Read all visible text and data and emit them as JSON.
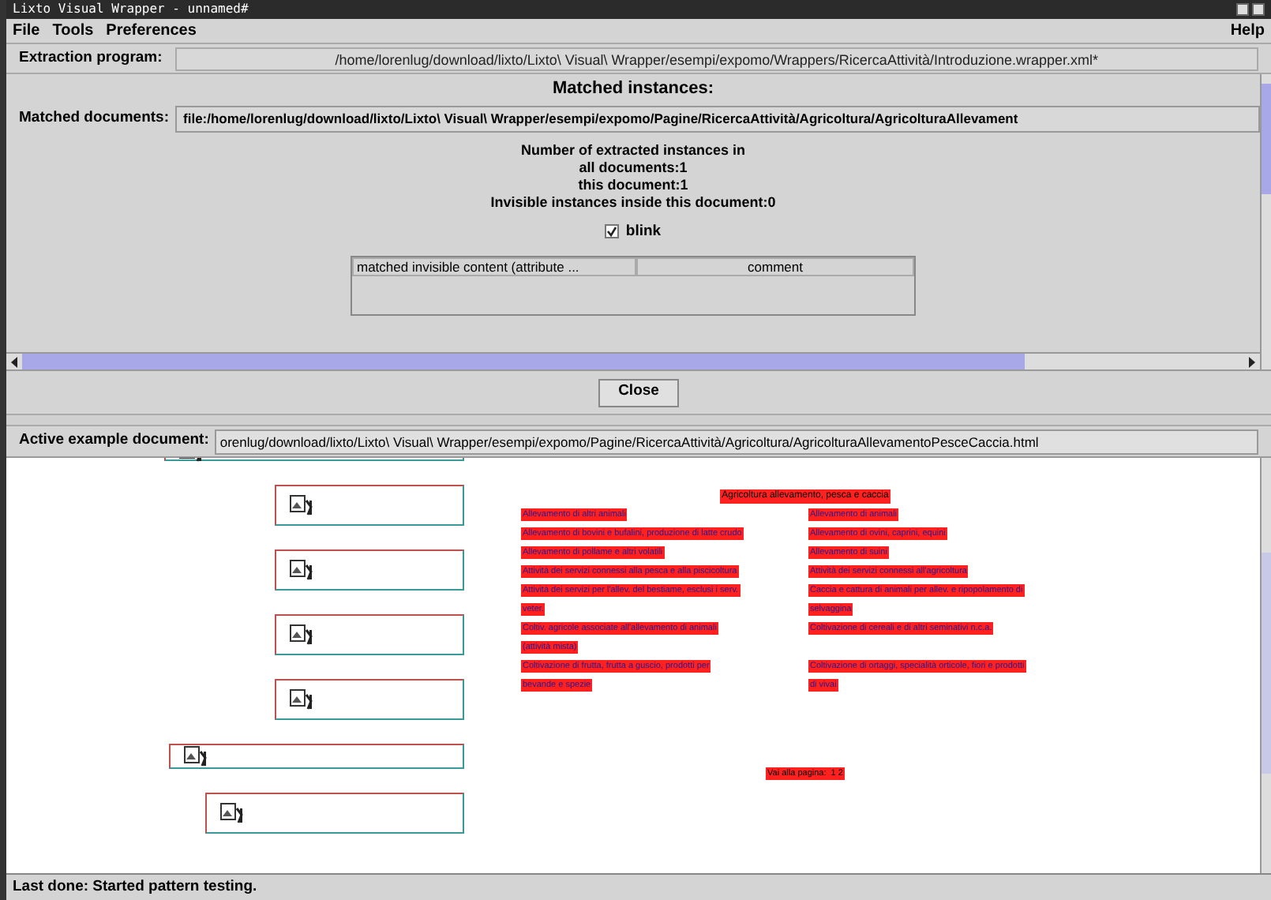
{
  "window": {
    "title": "Lixto Visual Wrapper - unnamed#"
  },
  "menu": [
    {
      "label": "File"
    },
    {
      "label": "Tools"
    },
    {
      "label": "Preferences"
    }
  ],
  "help_menu": "Help",
  "extraction_program": {
    "label": "Extraction program:",
    "value": "/home/lorenlug/download/lixto/Lixto\\ Visual\\ Wrapper/esempi/expomo/Wrappers/RicercaAttività/Introduzione.wrapper.xml*"
  },
  "matched": {
    "title": "Matched instances:",
    "documents_label": "Matched documents:",
    "documents_value": "file:/home/lorenlug/download/lixto/Lixto\\ Visual\\ Wrapper/esempi/expomo/Pagine/RicercaAttività/Agricoltura/AgricolturaAllevament",
    "counts": [
      "Number of extracted instances in",
      "all documents:1",
      "this document:1",
      "Invisible instances inside this document:0"
    ],
    "blink": {
      "label": "blink",
      "checked": true
    },
    "table_columns": [
      "matched invisible content (attribute ...",
      "comment"
    ]
  },
  "close_button": "Close",
  "active_document": {
    "label": "Active example document:",
    "value": "orenlug/download/lixto/Lixto\\ Visual\\ Wrapper/esempi/expomo/Pagine/RicercaAttività/Agricoltura/AgricolturaAllevamentoPesceCaccia.html"
  },
  "document": {
    "heading": "Agricoltura allevamento, pesca e caccia",
    "link_rows": [
      {
        "left": "Allevamento di altri animali",
        "right": "Allevamento di animali"
      },
      {
        "left": "Allevamento di bovini e bufalini, produzione di latte crudo",
        "right": "Allevamento di ovini, caprini, equini"
      },
      {
        "left": "Allevamento di pollame e altri volatili",
        "right": "Allevamento di suini"
      },
      {
        "left": "Attività dei servizi connessi alla pesca e alla piscicoltura",
        "right": "Attività dei servizi connessi all'agricoltura"
      },
      {
        "left": "Attività dei servizi per l'allev. del bestiame, esclusi i serv.",
        "right": "Caccia e cattura di animali per allev. e ripopolamento di"
      },
      {
        "left": "veter.",
        "right": "selvaggina"
      },
      {
        "left": "Coltiv. agricole associate all'allevamento di animali",
        "right": "Coltivazione di cereali e di altri seminativi n.c.a."
      },
      {
        "left": "(attività mista)"
      },
      {
        "left": "Coltivazione di frutta, frutta a guscio, prodotti per",
        "right": "Coltivazione di ortaggi, specialità orticole, fiori e prodotti"
      },
      {
        "left": "bevande e spezie",
        "right": "di vivai"
      }
    ],
    "pager": "Vai alla pagina:  1 2"
  },
  "status_bar": "Last done: Started pattern testing."
}
